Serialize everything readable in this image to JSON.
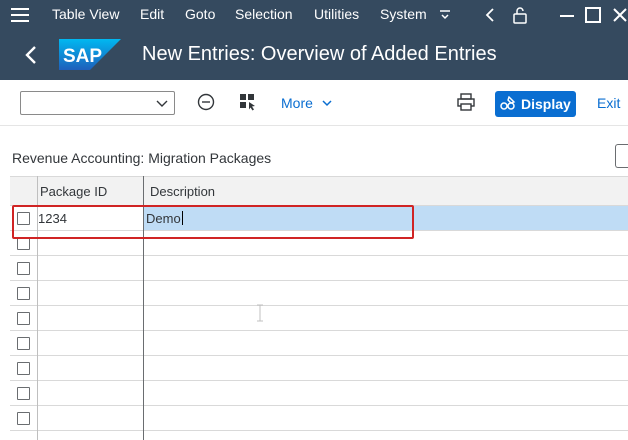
{
  "menubar": {
    "items": [
      "Table View",
      "Edit",
      "Goto",
      "Selection",
      "Utilities",
      "System"
    ]
  },
  "header": {
    "logo": "SAP",
    "title": "New Entries: Overview of Added Entries"
  },
  "toolbar": {
    "dropdown_value": "",
    "more_label": "More",
    "display_label": "Display",
    "exit_label": "Exit"
  },
  "section": {
    "title": "Revenue Accounting: Migration Packages"
  },
  "table": {
    "columns": [
      "Package ID",
      "Description"
    ],
    "rows": [
      {
        "package_id": "1234",
        "description": "Demo"
      }
    ],
    "empty_rows": 8
  },
  "colors": {
    "shell": "#354a5f",
    "accent": "#0a6ed1",
    "selection": "#bfdcf5",
    "highlight": "#d02424"
  }
}
